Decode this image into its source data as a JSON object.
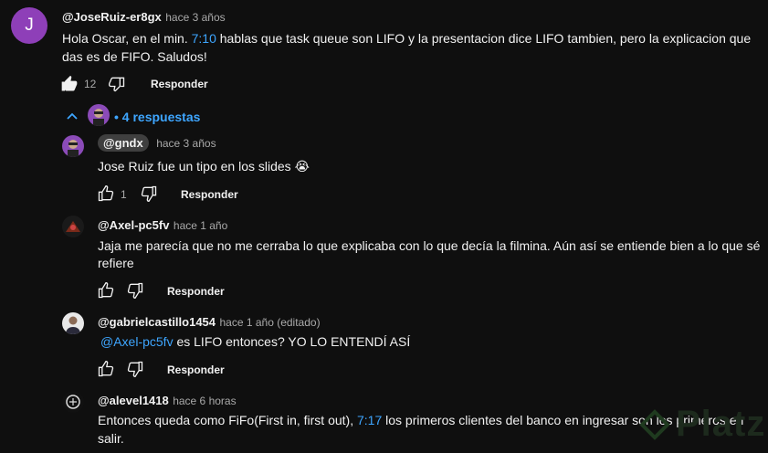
{
  "main_comment": {
    "avatar_letter": "J",
    "avatar_color": "#8e3fb8",
    "author": "@JoseRuiz-er8gx",
    "time": "hace 3 años",
    "text_part1": "Hola Oscar, en el min. ",
    "timestamp_link": "7:10",
    "text_part2": " hablas que task queue son LIFO y la presentacion dice LIFO tambien, pero la explicacion que",
    "text_line2": "das es de FIFO. Saludos!",
    "likes": "12",
    "reply_label": "Responder"
  },
  "replies_toggle": {
    "label": "• 4 respuestas"
  },
  "replies": [
    {
      "author": "@gndx",
      "time": "hace 3 años",
      "text": "Jose Ruiz fue un tipo en los slides 😭",
      "likes": "1",
      "reply_label": "Responder"
    },
    {
      "author": "@Axel-pc5fv",
      "time": "hace 1 año",
      "text_line1": "Jaja me parecía que no me cerraba lo que explicaba con lo que decía la filmina. Aún así se entiende bien a lo que sé",
      "text_line2": "refiere",
      "reply_label": "Responder"
    },
    {
      "author": "@gabrielcastillo1454",
      "time": "hace 1 año (editado)",
      "mention": "@Axel-pc5fv",
      "text": " es LIFO entonces? YO LO ENTENDÍ ASÍ",
      "reply_label": "Responder"
    },
    {
      "author": "@alevel1418",
      "time": "hace 6 horas",
      "text_part1": "Entonces queda como FiFo(First in, first out), ",
      "timestamp_link": "7:17",
      "text_part2": " los primeros clientes del banco en ingresar son los primeros en",
      "text_line2": "salir."
    }
  ],
  "watermark": "Platzi",
  "colors": {
    "background": "#0f0f0f",
    "link": "#3ea6ff",
    "text": "#f1f1f1",
    "secondary": "#aaaaaa"
  }
}
